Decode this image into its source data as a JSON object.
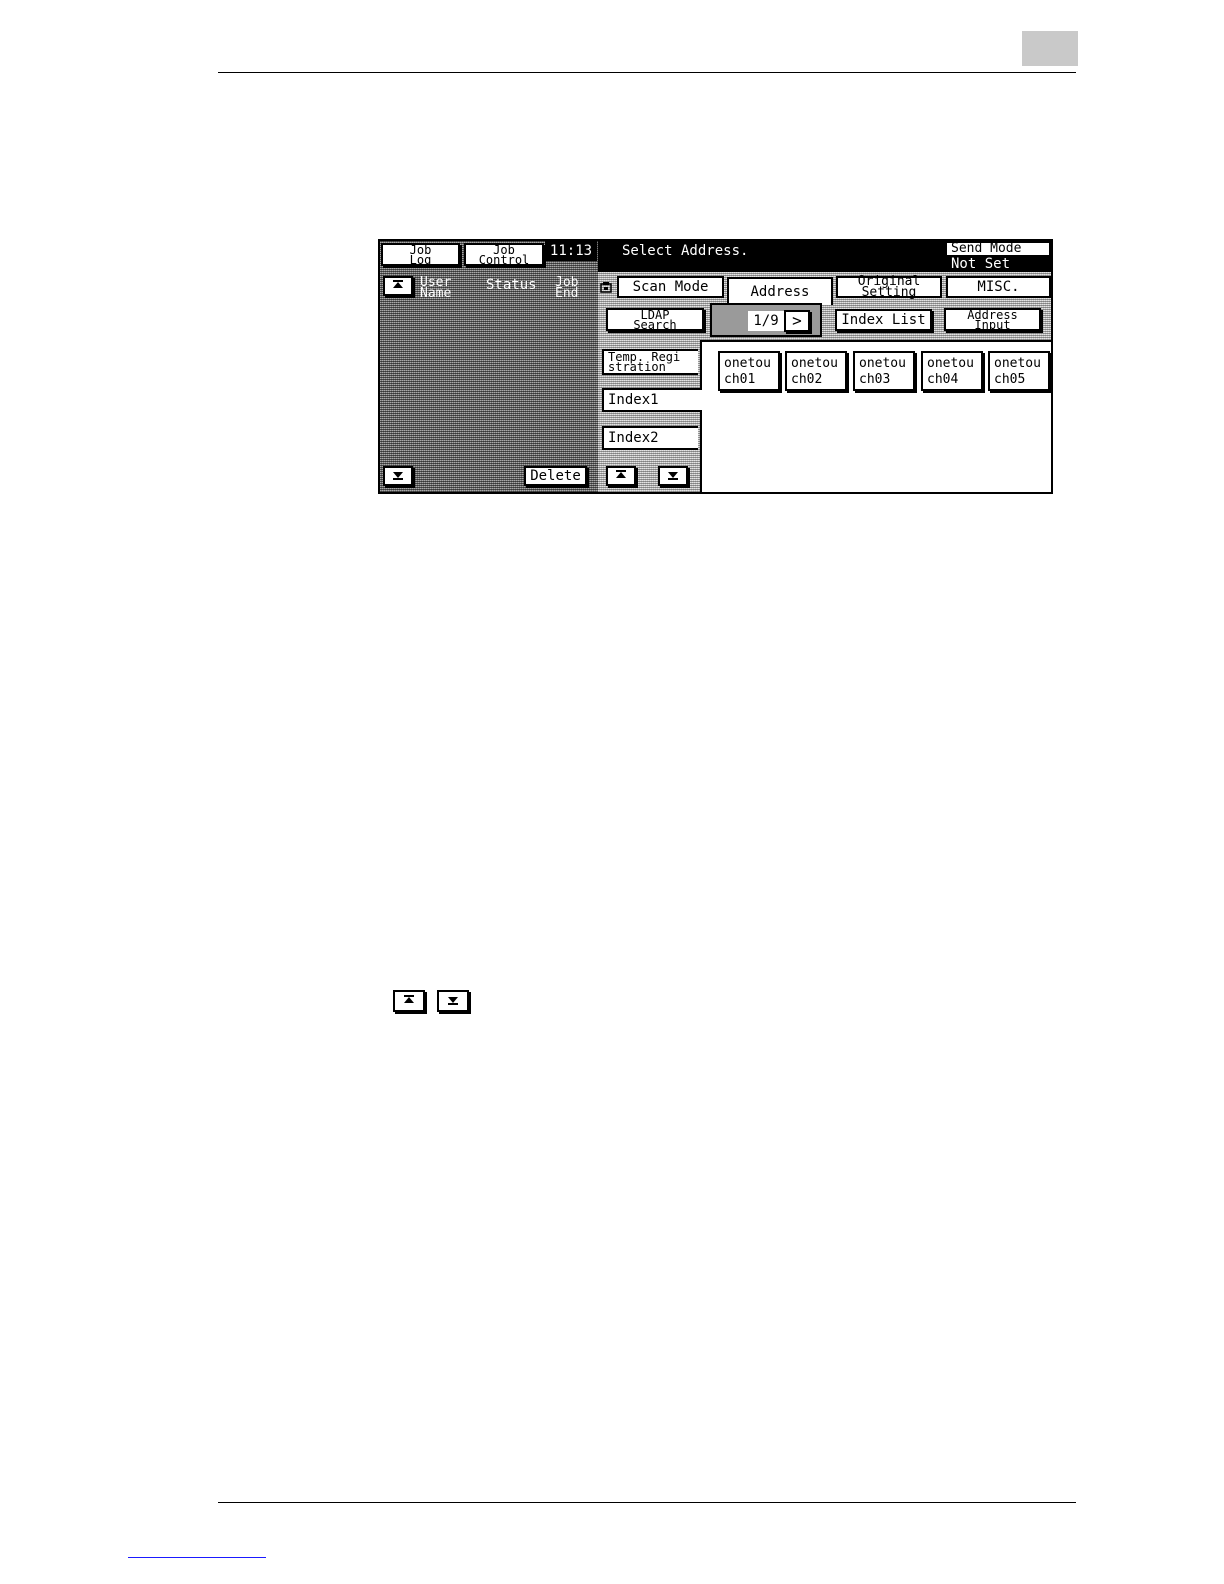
{
  "panel": {
    "job_log": "Job\nLog",
    "job_control": "Job\nControl",
    "clock": "11:13",
    "message": "Select Address.",
    "send_mode_label": "Send Mode",
    "send_mode_value": "Not Set",
    "columns": {
      "user_name": "User\nName",
      "status": "Status",
      "job_end": "Job\nEnd"
    },
    "delete": "Delete",
    "tabs": {
      "scan_mode": "Scan Mode",
      "address": "Address",
      "original_setting": "Original\nSetting",
      "misc": "MISC."
    },
    "ldap_search": "LDAP\nSearch",
    "page_indicator": "1/9",
    "next": ">",
    "index_list": "Index List",
    "address_input": "Address\nInput",
    "temp_registration": "Temp. Regi\nstration",
    "index1": "Index1",
    "index2": "Index2",
    "addresses": [
      {
        "line1": "onetou",
        "line2": "ch01"
      },
      {
        "line1": "onetou",
        "line2": "ch02"
      },
      {
        "line1": "onetou",
        "line2": "ch03"
      },
      {
        "line1": "onetou",
        "line2": "ch04"
      },
      {
        "line1": "onetou",
        "line2": "ch05"
      }
    ],
    "icons": {
      "scroll_up": "top-arrow-icon",
      "scroll_down": "bottom-arrow-icon",
      "memory": "memory-icon"
    }
  },
  "inline_icons": [
    "top-arrow-icon",
    "bottom-arrow-icon"
  ]
}
